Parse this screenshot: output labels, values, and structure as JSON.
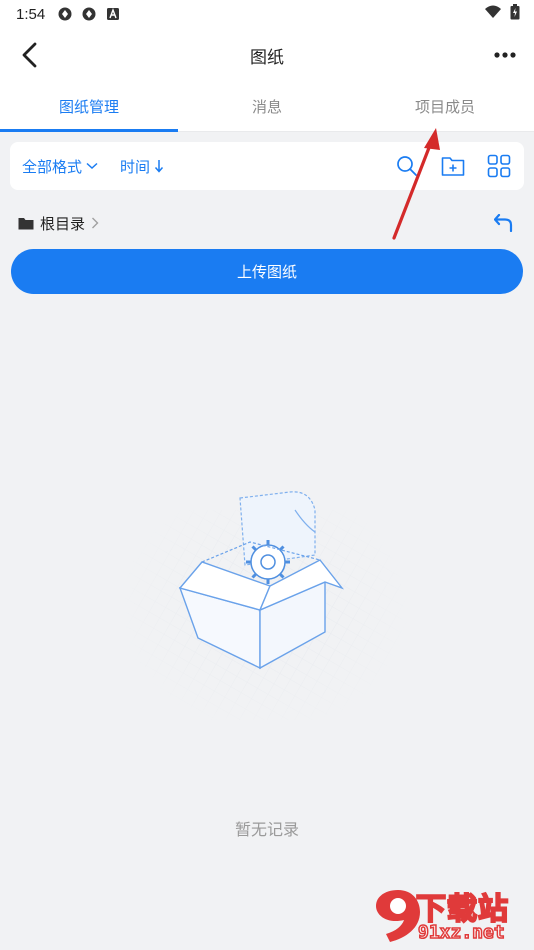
{
  "status_bar": {
    "time": "1:54",
    "icons": [
      "sync-icon",
      "sync-icon",
      "a-icon",
      "wifi-icon",
      "battery-icon"
    ]
  },
  "navbar": {
    "title": "图纸"
  },
  "tabs": [
    {
      "label": "图纸管理",
      "active": true
    },
    {
      "label": "消息",
      "active": false
    },
    {
      "label": "项目成员",
      "active": false
    }
  ],
  "toolbar": {
    "format_filter": "全部格式",
    "sort": "时间",
    "tools": [
      "search-icon",
      "new-folder-icon",
      "grid-view-icon"
    ]
  },
  "breadcrumb": {
    "root": "根目录"
  },
  "upload_button": "上传图纸",
  "empty_state": {
    "text": "暂无记录"
  },
  "watermark": {
    "line1": "下载站",
    "line2": "91xz.net"
  },
  "colors": {
    "accent": "#1a7cf2",
    "background": "#f1f2f4",
    "annotation_arrow": "#d42a2a"
  }
}
